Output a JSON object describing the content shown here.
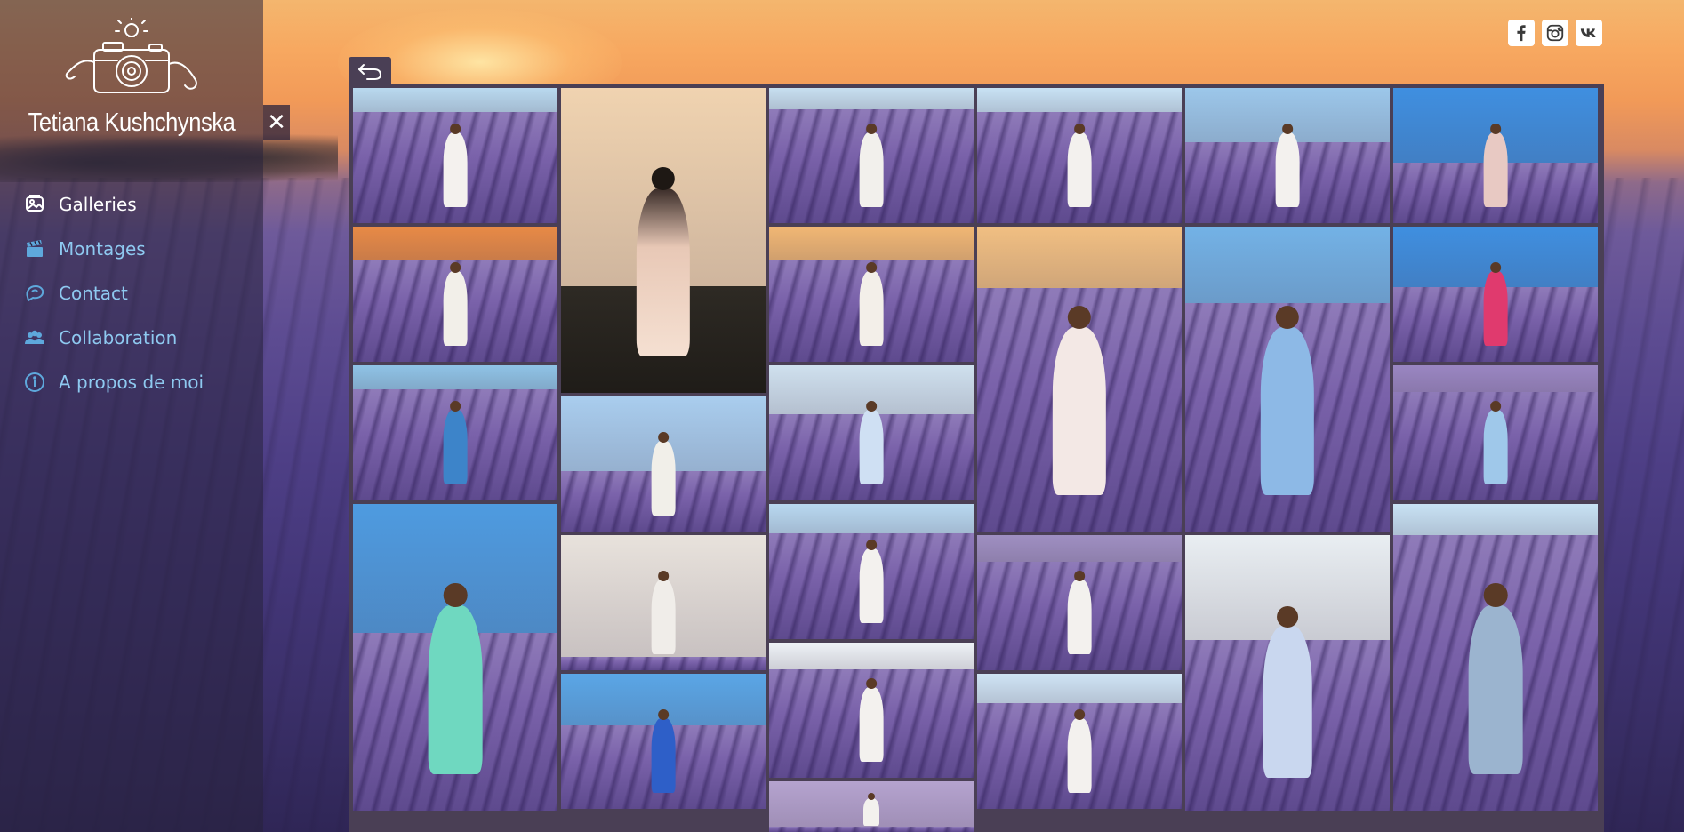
{
  "site": {
    "title": "Tetiana Kushchynska"
  },
  "nav": {
    "items": [
      {
        "label": "Galleries",
        "icon": "galleries-icon",
        "active": true
      },
      {
        "label": "Montages",
        "icon": "clapperboard-icon",
        "active": false
      },
      {
        "label": "Contact",
        "icon": "chat-icon",
        "active": false
      },
      {
        "label": "Collaboration",
        "icon": "people-icon",
        "active": false
      },
      {
        "label": "A propos de moi",
        "icon": "info-icon",
        "active": false
      }
    ]
  },
  "social": [
    "facebook-icon",
    "instagram-icon",
    "vk-icon"
  ],
  "colors": {
    "nav_link": "#8ec9f0",
    "nav_active": "#ffffff",
    "frame": "#4a3f55"
  },
  "gallery": {
    "photo_count": 29
  }
}
